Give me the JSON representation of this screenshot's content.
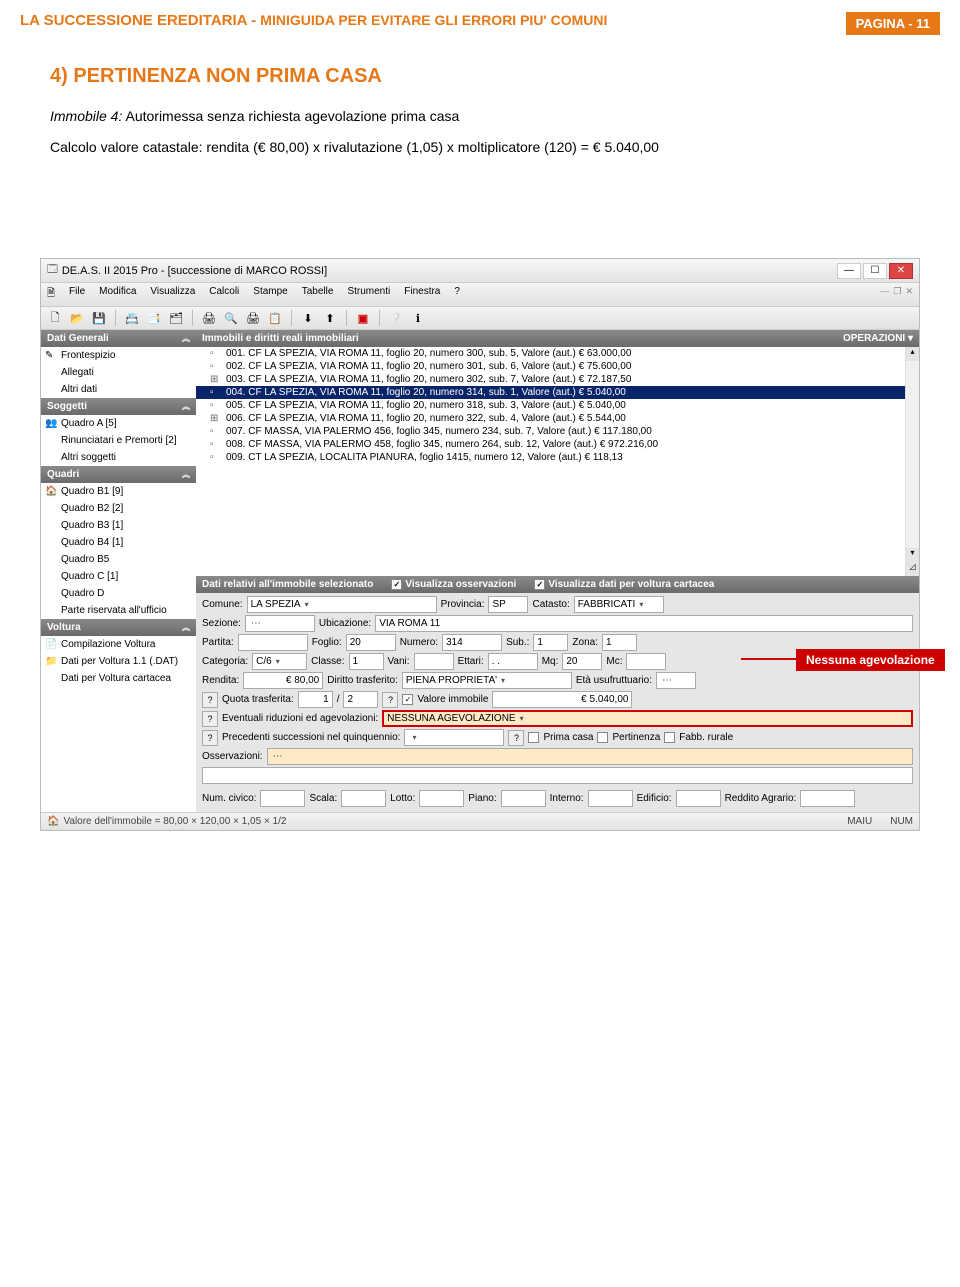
{
  "page": {
    "header_title": "LA SUCCESSIONE EREDITARIA - ",
    "header_sub": "MINIGUIDA PER EVITARE GLI ERRORI PIU' COMUNI",
    "page_label": "PAGINA - 11"
  },
  "section": {
    "heading": "4) PERTINENZA NON PRIMA CASA",
    "line1_a": "Immobile 4:",
    "line1_b": " Autorimessa senza richiesta agevolazione prima casa",
    "line2": "Calcolo valore catastale: rendita (€ 80,00) x rivalutazione (1,05) x moltiplicatore (120) = € 5.040,00"
  },
  "app": {
    "title": "DE.A.S. II 2015 Pro - [successione di MARCO ROSSI]",
    "menus": [
      "File",
      "Modifica",
      "Visualizza",
      "Calcoli",
      "Stampe",
      "Tabelle",
      "Strumenti",
      "Finestra",
      "?"
    ],
    "sidebar": {
      "groups": [
        {
          "title": "Dati Generali",
          "items": [
            {
              "label": "Frontespizio",
              "icon": "📝"
            },
            {
              "label": "Allegati",
              "icon": ""
            },
            {
              "label": "Altri dati",
              "icon": ""
            }
          ]
        },
        {
          "title": "Soggetti",
          "items": [
            {
              "label": "Quadro A [5]",
              "icon": "👥"
            },
            {
              "label": "Rinunciatari e Premorti [2]",
              "icon": ""
            },
            {
              "label": "Altri soggetti",
              "icon": ""
            }
          ]
        },
        {
          "title": "Quadri",
          "items": [
            {
              "label": "Quadro B1 [9]",
              "icon": "🏠"
            },
            {
              "label": "Quadro B2 [2]",
              "icon": ""
            },
            {
              "label": "Quadro B3 [1]",
              "icon": ""
            },
            {
              "label": "Quadro B4 [1]",
              "icon": ""
            },
            {
              "label": "Quadro B5",
              "icon": ""
            },
            {
              "label": "Quadro C [1]",
              "icon": ""
            },
            {
              "label": "Quadro D",
              "icon": ""
            },
            {
              "label": "Parte riservata all'ufficio",
              "icon": ""
            }
          ]
        },
        {
          "title": "Voltura",
          "items": [
            {
              "label": "Compilazione Voltura",
              "icon": "📄"
            },
            {
              "label": "Dati per Voltura 1.1 (.DAT)",
              "icon": "📁"
            },
            {
              "label": "Dati per Voltura cartacea",
              "icon": ""
            }
          ]
        }
      ]
    },
    "list": {
      "title": "Immobili e diritti reali immobiliari",
      "ops": "OPERAZIONI  ▾",
      "rows": [
        "001. CF LA SPEZIA, VIA ROMA 11, foglio 20, numero 300, sub. 5, Valore (aut.) € 63.000,00",
        "002. CF LA SPEZIA, VIA ROMA 11, foglio 20, numero 301, sub. 6, Valore (aut.) € 75.600,00",
        "003. CF LA SPEZIA, VIA ROMA 11, foglio 20, numero 302, sub. 7, Valore (aut.) € 72.187,50",
        "004. CF LA SPEZIA, VIA ROMA 11, foglio 20, numero 314, sub. 1, Valore (aut.) € 5.040,00",
        "005. CF LA SPEZIA, VIA ROMA 11, foglio 20, numero 318, sub. 3, Valore (aut.) € 5.040,00",
        "006. CF LA SPEZIA, VIA ROMA 11, foglio 20, numero 322, sub. 4, Valore (aut.) € 5.544,00",
        "007. CF MASSA, VIA PALERMO 456, foglio 345, numero 234, sub. 7, Valore (aut.) € 117.180,00",
        "008. CF MASSA, VIA PALERMO 458, foglio 345, numero 264, sub. 12, Valore (aut.) € 972.216,00",
        "009. CT LA SPEZIA, LOCALITA PIANURA, foglio 1415, numero 12, Valore (aut.) € 118,13"
      ],
      "selected_index": 3
    },
    "details": {
      "title": "Dati relativi all'immobile selezionato",
      "chk1": "Visualizza osservazioni",
      "chk2": "Visualizza dati per voltura cartacea",
      "comune_lbl": "Comune:",
      "comune": "LA SPEZIA",
      "provincia_lbl": "Provincia:",
      "provincia": "SP",
      "catasto_lbl": "Catasto:",
      "catasto": "FABBRICATI",
      "sezione_lbl": "Sezione:",
      "sezione": "",
      "ubicazione_lbl": "Ubicazione:",
      "ubicazione": "VIA ROMA 11",
      "partita_lbl": "Partita:",
      "partita": "",
      "foglio_lbl": "Foglio:",
      "foglio": "20",
      "numero_lbl": "Numero:",
      "numero": "314",
      "sub_lbl": "Sub.:",
      "sub": "1",
      "zona_lbl": "Zona:",
      "zona": "1",
      "categoria_lbl": "Categoria:",
      "categoria": "C/6",
      "classe_lbl": "Classe:",
      "classe": "1",
      "vani_lbl": "Vani:",
      "vani": "",
      "ettari_lbl": "Ettari:",
      "ettari": ". .",
      "mq_lbl": "Mq:",
      "mq": "20",
      "mc_lbl": "Mc:",
      "mc": "",
      "rendita_lbl": "Rendita:",
      "rendita": "€ 80,00",
      "diritto_lbl": "Diritto trasferito:",
      "diritto": "PIENA PROPRIETA'",
      "eta_lbl": "Età usufruttuario:",
      "eta": "",
      "quota_lbl": "Quota trasferita:",
      "quota_n": "1",
      "quota_sep": "/",
      "quota_d": "2",
      "valore_chk": "Valore immobile",
      "valore": "€ 5.040,00",
      "agev_lbl": "Eventuali riduzioni ed agevolazioni:",
      "agev": "NESSUNA AGEVOLAZIONE",
      "prec_lbl": "Precedenti successioni nel quinquennio:",
      "prima_casa": "Prima casa",
      "pertinenza": "Pertinenza",
      "fabb": "Fabb. rurale",
      "oss_lbl": "Osservazioni:",
      "numcivico_lbl": "Num. civico:",
      "scala_lbl": "Scala:",
      "lotto_lbl": "Lotto:",
      "piano_lbl": "Piano:",
      "interno_lbl": "Interno:",
      "edificio_lbl": "Edificio:",
      "reddito_lbl": "Reddito Agrario:"
    },
    "status": {
      "left": "Valore dell'immobile = 80,00 × 120,00 × 1,05 × 1/2",
      "maiu": "MAIU",
      "num": "NUM"
    }
  },
  "callout": {
    "text": "Nessuna agevolazione"
  }
}
